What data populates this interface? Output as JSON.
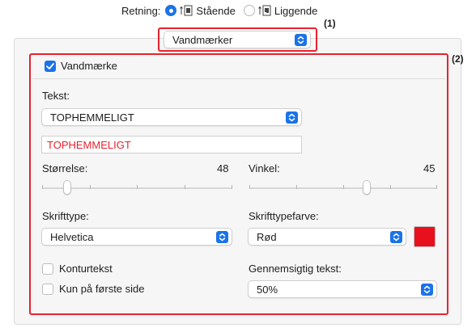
{
  "orientation": {
    "label": "Retning:",
    "options": [
      {
        "label": "Stående",
        "selected": true
      },
      {
        "label": "Liggende",
        "selected": false
      }
    ]
  },
  "section_popup": {
    "value": "Vandmærker"
  },
  "callouts": {
    "one": "(1)",
    "two": "(2)"
  },
  "watermark": {
    "enable_label": "Vandmærke",
    "enabled": true,
    "text_label": "Tekst:",
    "text_popup_value": "TOPHEMMELIGT",
    "text_field_value": "TOPHEMMELIGT",
    "size_label": "Størrelse:",
    "size_value": "48",
    "size_level": 0.13,
    "angle_label": "Vinkel:",
    "angle_value": "45",
    "angle_level": 0.625,
    "font_label": "Skrifttype:",
    "font_value": "Helvetica",
    "font_color_label": "Skrifttypefarve:",
    "font_color_value": "Rød",
    "font_color_hex": "#e8101c",
    "outline_label": "Konturtekst",
    "outline_checked": false,
    "first_page_label": "Kun på første side",
    "first_page_checked": false,
    "transparency_label": "Gennemsigtig tekst:",
    "transparency_value": "50%"
  },
  "colors": {
    "accent": "#1a73e8",
    "highlight": "#e8222e"
  }
}
